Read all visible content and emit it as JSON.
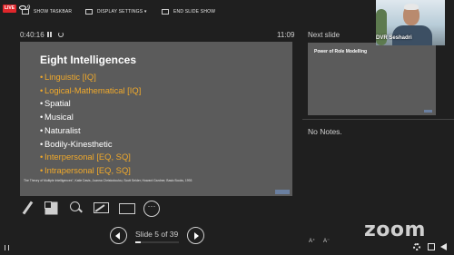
{
  "topbar": {
    "live_label": "LIVE",
    "viewer_count": "9",
    "show_taskbar": "SHOW TASKBAR",
    "display_settings": "DISPLAY SETTINGS ▾",
    "end_slide_show": "END SLIDE SHOW"
  },
  "timer": {
    "elapsed": "0:40:16",
    "clock": "11:09"
  },
  "current_slide": {
    "title": "Eight Intelligences",
    "bullets": [
      {
        "text": "Linguistic [IQ]",
        "highlight": true
      },
      {
        "text": "Logical-Mathematical [IQ]",
        "highlight": true
      },
      {
        "text": "Spatial",
        "highlight": false
      },
      {
        "text": "Musical",
        "highlight": false
      },
      {
        "text": "Naturalist",
        "highlight": false
      },
      {
        "text": "Bodily-Kinesthetic",
        "highlight": false
      },
      {
        "text": "Interpersonal [EQ, SQ]",
        "highlight": true
      },
      {
        "text": "Intrapersonal [EQ, SQ]",
        "highlight": true
      }
    ],
    "citation": "The Theory of Multiple Intelligences”, Katie Davis, Joanna Christodoulou, Scott Seider, Howard Gardner, Basic Books, 1993",
    "highlight_color": "#f0a92b"
  },
  "navigation": {
    "slide_counter": "Slide 5 of 39",
    "progress": 0.128
  },
  "next_slide": {
    "label": "Next slide",
    "title": "Power of Role Modelling"
  },
  "notes": {
    "text": "No Notes."
  },
  "webcam": {
    "name": "DVR Seshadri"
  },
  "zoom_logo": "zoom",
  "font_controls": {
    "increase": "A⁺",
    "decrease": "A⁻"
  },
  "icons": [
    "pen-icon",
    "see-all-slides-icon",
    "zoom-in-icon",
    "screen-share-icon",
    "subtitles-icon",
    "more-options-icon",
    "previous-icon",
    "next-icon",
    "settings-icon",
    "fullscreen-icon",
    "volume-icon"
  ]
}
